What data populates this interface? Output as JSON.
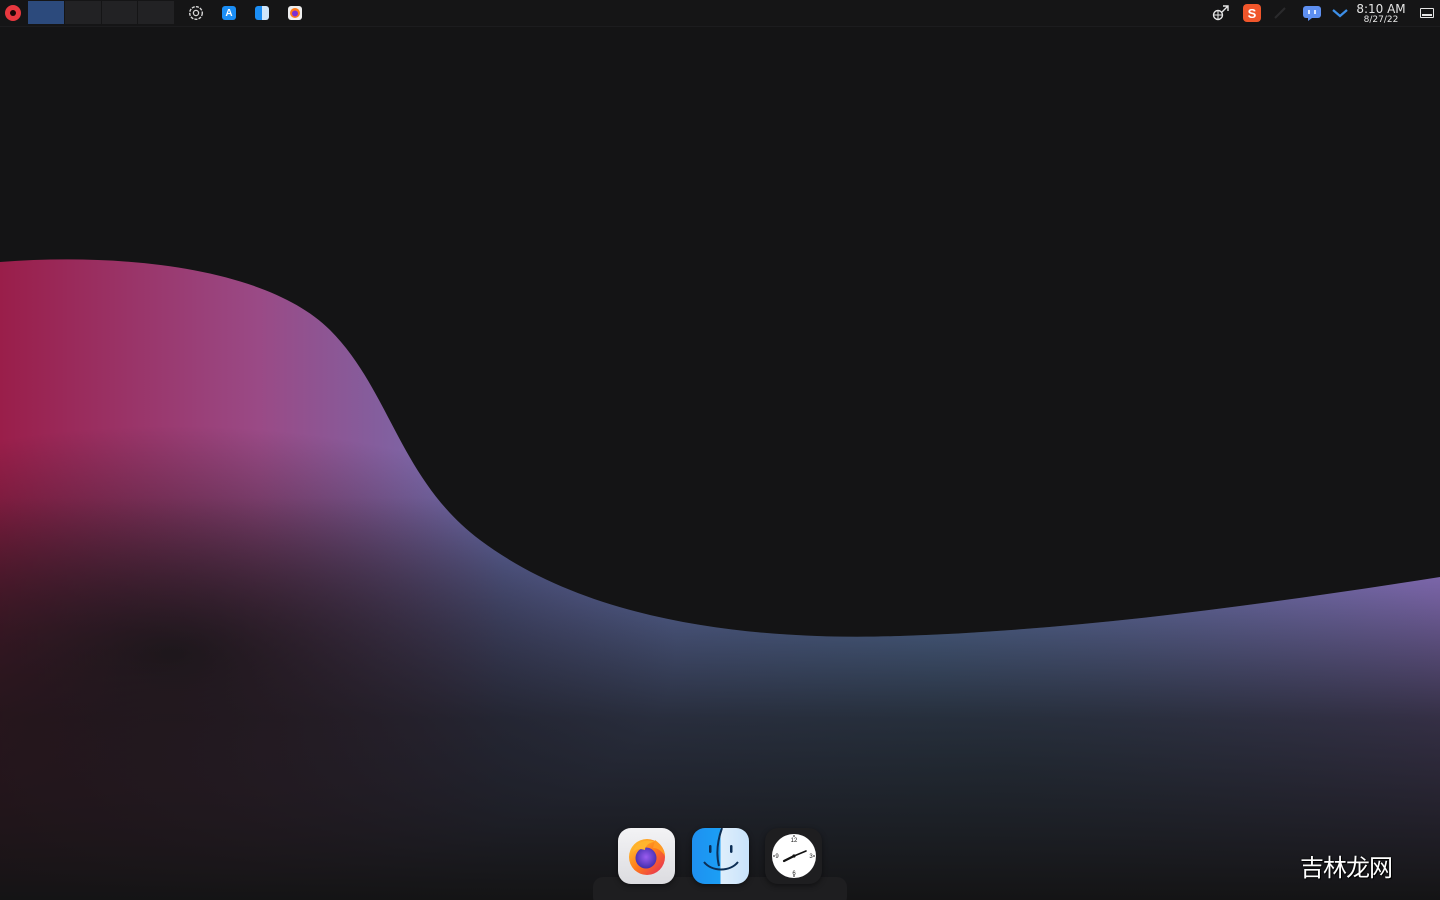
{
  "top_panel": {
    "pager": {
      "desktops": 4,
      "active_index": 0
    },
    "launchers": [
      {
        "icon": "settings-icon"
      },
      {
        "icon": "app-store-icon"
      },
      {
        "icon": "finder-icon"
      },
      {
        "icon": "firefox-icon"
      }
    ],
    "tray": {
      "input_method_glyph": "S",
      "clock": {
        "time": "8:10 AM",
        "date": "8/27/22"
      }
    }
  },
  "dock": {
    "items": [
      {
        "name": "Firefox",
        "icon": "firefox-icon"
      },
      {
        "name": "Finder",
        "icon": "finder-icon"
      },
      {
        "name": "Clock",
        "icon": "clock-icon"
      }
    ],
    "clock_face_numerals": [
      "12",
      "3",
      "6",
      "9"
    ]
  },
  "watermark": {
    "text": "吉林龙网"
  },
  "colors": {
    "panel_bg": "#151516",
    "desktop_bg": "#141415",
    "active_desktop": "#2c4a7c",
    "wave_pink": "#a8427a",
    "wave_blue": "#6b86c4",
    "wave_purple": "#a184e0"
  }
}
